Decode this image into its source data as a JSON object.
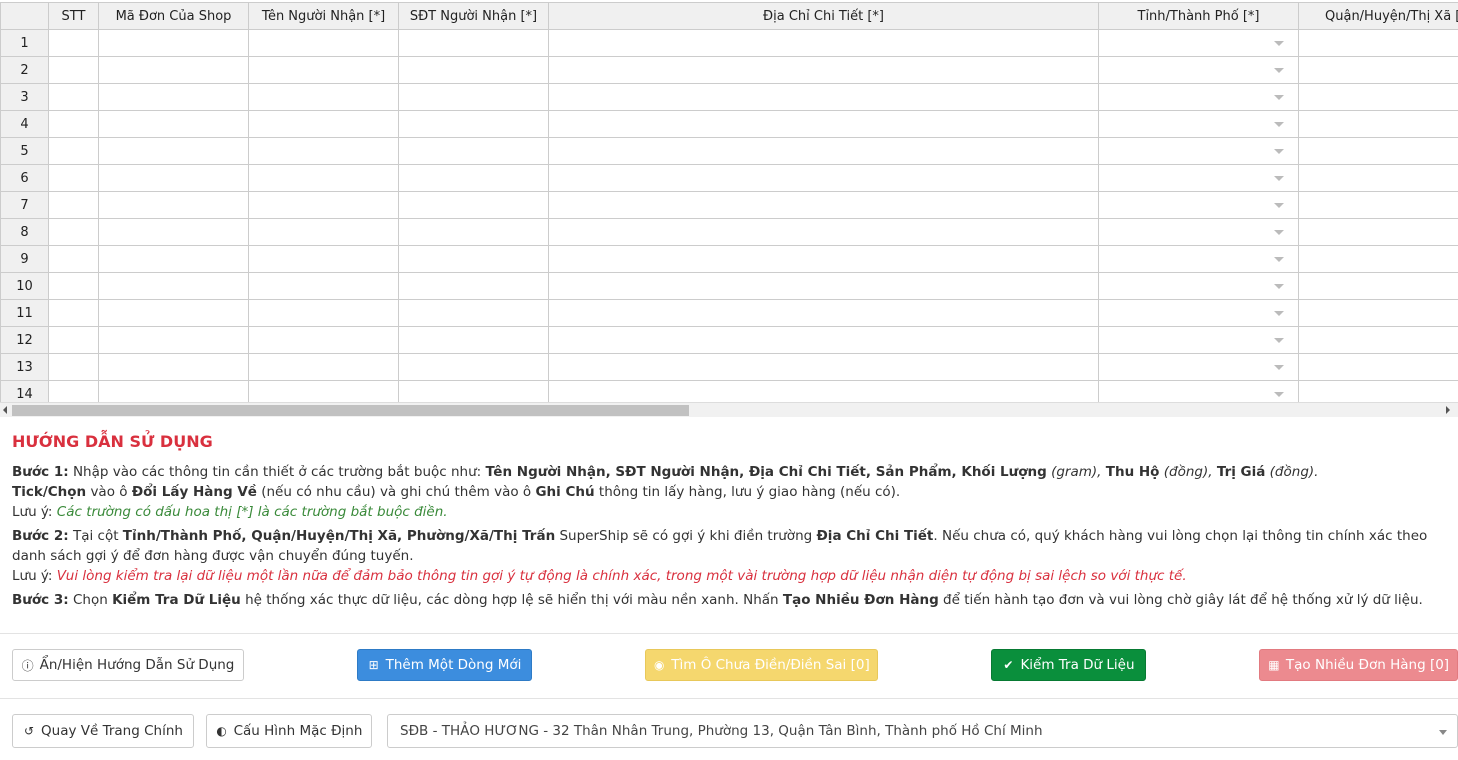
{
  "grid": {
    "headers": [
      "",
      "STT",
      "Mã Đơn Của Shop",
      "Tên Người Nhận [*]",
      "SĐT Người Nhận [*]",
      "Địa Chỉ Chi Tiết [*]",
      "Tỉnh/Thành Phố [*]",
      "Quận/Huyện/Thị Xã [*]"
    ],
    "rows": [
      "1",
      "2",
      "3",
      "4",
      "5",
      "6",
      "7",
      "8",
      "9",
      "10",
      "11",
      "12",
      "13",
      "14"
    ]
  },
  "guide": {
    "title": "HƯỚNG DẪN SỬ DỤNG",
    "step1": {
      "label": "Bước 1:",
      "text1": " Nhập vào các thông tin cần thiết ở các trường bắt buộc như: ",
      "fields": "Tên Người Nhận, SĐT Người Nhận, Địa Chỉ Chi Tiết, Sản Phẩm, Khối Lượng",
      "gram": " (gram), ",
      "thuho": "Thu Hộ",
      "dong1": " (đồng), ",
      "trigia": "Trị Giá",
      "dong2": " (đồng)."
    },
    "tick": {
      "label": "Tick/Chọn",
      "t1": " vào ô ",
      "doilay": "Đổi Lấy Hàng Về",
      "t2": " (nếu có nhu cầu) và ghi chú thêm vào ô ",
      "ghichu": "Ghi Chú",
      "t3": " thông tin lấy hàng, lưu ý giao hàng (nếu có)."
    },
    "note1": {
      "label": "Lưu ý: ",
      "text": "Các trường có dấu hoa thị [*] là các trường bắt buộc điền."
    },
    "step2": {
      "label": "Bước 2:",
      "t1": " Tại cột ",
      "cols": "Tỉnh/Thành Phố, Quận/Huyện/Thị Xã, Phường/Xã/Thị Trấn",
      "t2": " SuperShip sẽ có gợi ý khi điền trường ",
      "diachi": "Địa Chỉ Chi Tiết",
      "t3": ". Nếu chưa có, quý khách hàng vui lòng chọn lại thông tin chính xác theo danh sách gợi ý để đơn hàng được vận chuyển đúng tuyến."
    },
    "note2": {
      "label": "Lưu ý: ",
      "text": "Vui lòng kiểm tra lại dữ liệu một lần nữa để đảm bảo thông tin gợi ý tự động là chính xác, trong một vài trường hợp dữ liệu nhận diện tự động bị sai lệch so với thực tế."
    },
    "step3": {
      "label": "Bước 3:",
      "t1": " Chọn ",
      "kiemtra": "Kiểm Tra Dữ Liệu",
      "t2": " hệ thống xác thực dữ liệu, các dòng hợp lệ sẽ hiển thị với màu nền xanh. Nhấn ",
      "taonhieu": "Tạo Nhiều Đơn Hàng",
      "t3": " để tiến hành tạo đơn và vui lòng chờ giây lát để hệ thống xử lý dữ liệu."
    }
  },
  "buttons": {
    "toggle_guide": "Ẩn/Hiện Hướng Dẫn Sử Dụng",
    "add_row": "Thêm Một Dòng Mới",
    "find_empty": "Tìm Ô Chưa Điền/Điền Sai [0]",
    "check_data": "Kiểm Tra Dữ Liệu",
    "create_orders": "Tạo Nhiều Đơn Hàng [0]",
    "back_home": "Quay Về Trang Chính",
    "default_config": "Cấu Hình Mặc Định"
  },
  "pickup_select": {
    "value": "SĐB - THẢO HƯƠNG - 32 Thân Nhân Trung, Phường 13, Quận Tân Bình, Thành phố Hồ Chí Minh"
  },
  "icons": {
    "info": "info-circle-icon",
    "plus": "plus-square-icon",
    "eye": "eye-icon",
    "check": "check-icon",
    "table": "table-icon",
    "undo": "undo-icon",
    "contrast": "contrast-icon"
  },
  "colors": {
    "primary": "#3c8dde",
    "warning": "#f5d76e",
    "success": "#0a8f3c",
    "danger": "#ec8a8f",
    "title": "#d9303e"
  }
}
